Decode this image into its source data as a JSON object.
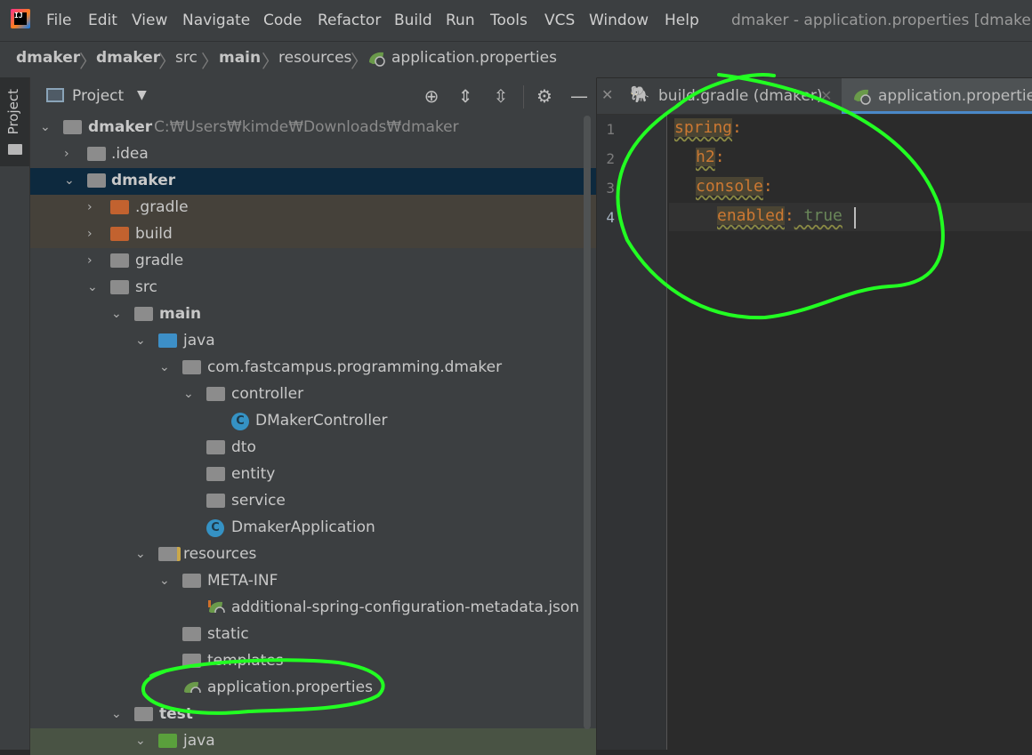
{
  "menu": {
    "items": [
      "File",
      "Edit",
      "View",
      "Navigate",
      "Code",
      "Refactor",
      "Build",
      "Run",
      "Tools",
      "VCS",
      "Window",
      "Help"
    ],
    "window_title": "dmaker - application.properties [dmaker.c"
  },
  "breadcrumb": [
    "dmaker",
    "dmaker",
    "src",
    "main",
    "resources",
    "application.properties"
  ],
  "project_panel": {
    "title": "Project",
    "strip_label": "Project"
  },
  "tree": [
    {
      "label": "dmaker",
      "path": "C:₩Users₩kimde₩Downloads₩dmaker"
    },
    {
      "label": ".idea"
    },
    {
      "label": "dmaker"
    },
    {
      "label": ".gradle"
    },
    {
      "label": "build"
    },
    {
      "label": "gradle"
    },
    {
      "label": "src"
    },
    {
      "label": "main"
    },
    {
      "label": "java"
    },
    {
      "label": "com.fastcampus.programming.dmaker"
    },
    {
      "label": "controller"
    },
    {
      "label": "DMakerController"
    },
    {
      "label": "dto"
    },
    {
      "label": "entity"
    },
    {
      "label": "service"
    },
    {
      "label": "DmakerApplication"
    },
    {
      "label": "resources"
    },
    {
      "label": "META-INF"
    },
    {
      "label": "additional-spring-configuration-metadata.json"
    },
    {
      "label": "static"
    },
    {
      "label": "templates"
    },
    {
      "label": "application.properties"
    },
    {
      "label": "test"
    },
    {
      "label": "java"
    }
  ],
  "tabs": [
    {
      "label": "build.gradle (dmaker)"
    },
    {
      "label": "application.properties"
    }
  ],
  "editor": {
    "line_numbers": [
      "1",
      "2",
      "3",
      "4"
    ],
    "lines": [
      {
        "key": "spring",
        "colon": ":",
        "value": ""
      },
      {
        "key": "h2",
        "colon": ":",
        "value": ""
      },
      {
        "key": "console",
        "colon": ":",
        "value": ""
      },
      {
        "key": "enabled",
        "colon": ":",
        "value": " true"
      }
    ]
  },
  "colors": {
    "keyword": "#cc7832",
    "string": "#6a8759",
    "selection": "#0d293e",
    "annotation_marker": "#22ff22"
  }
}
